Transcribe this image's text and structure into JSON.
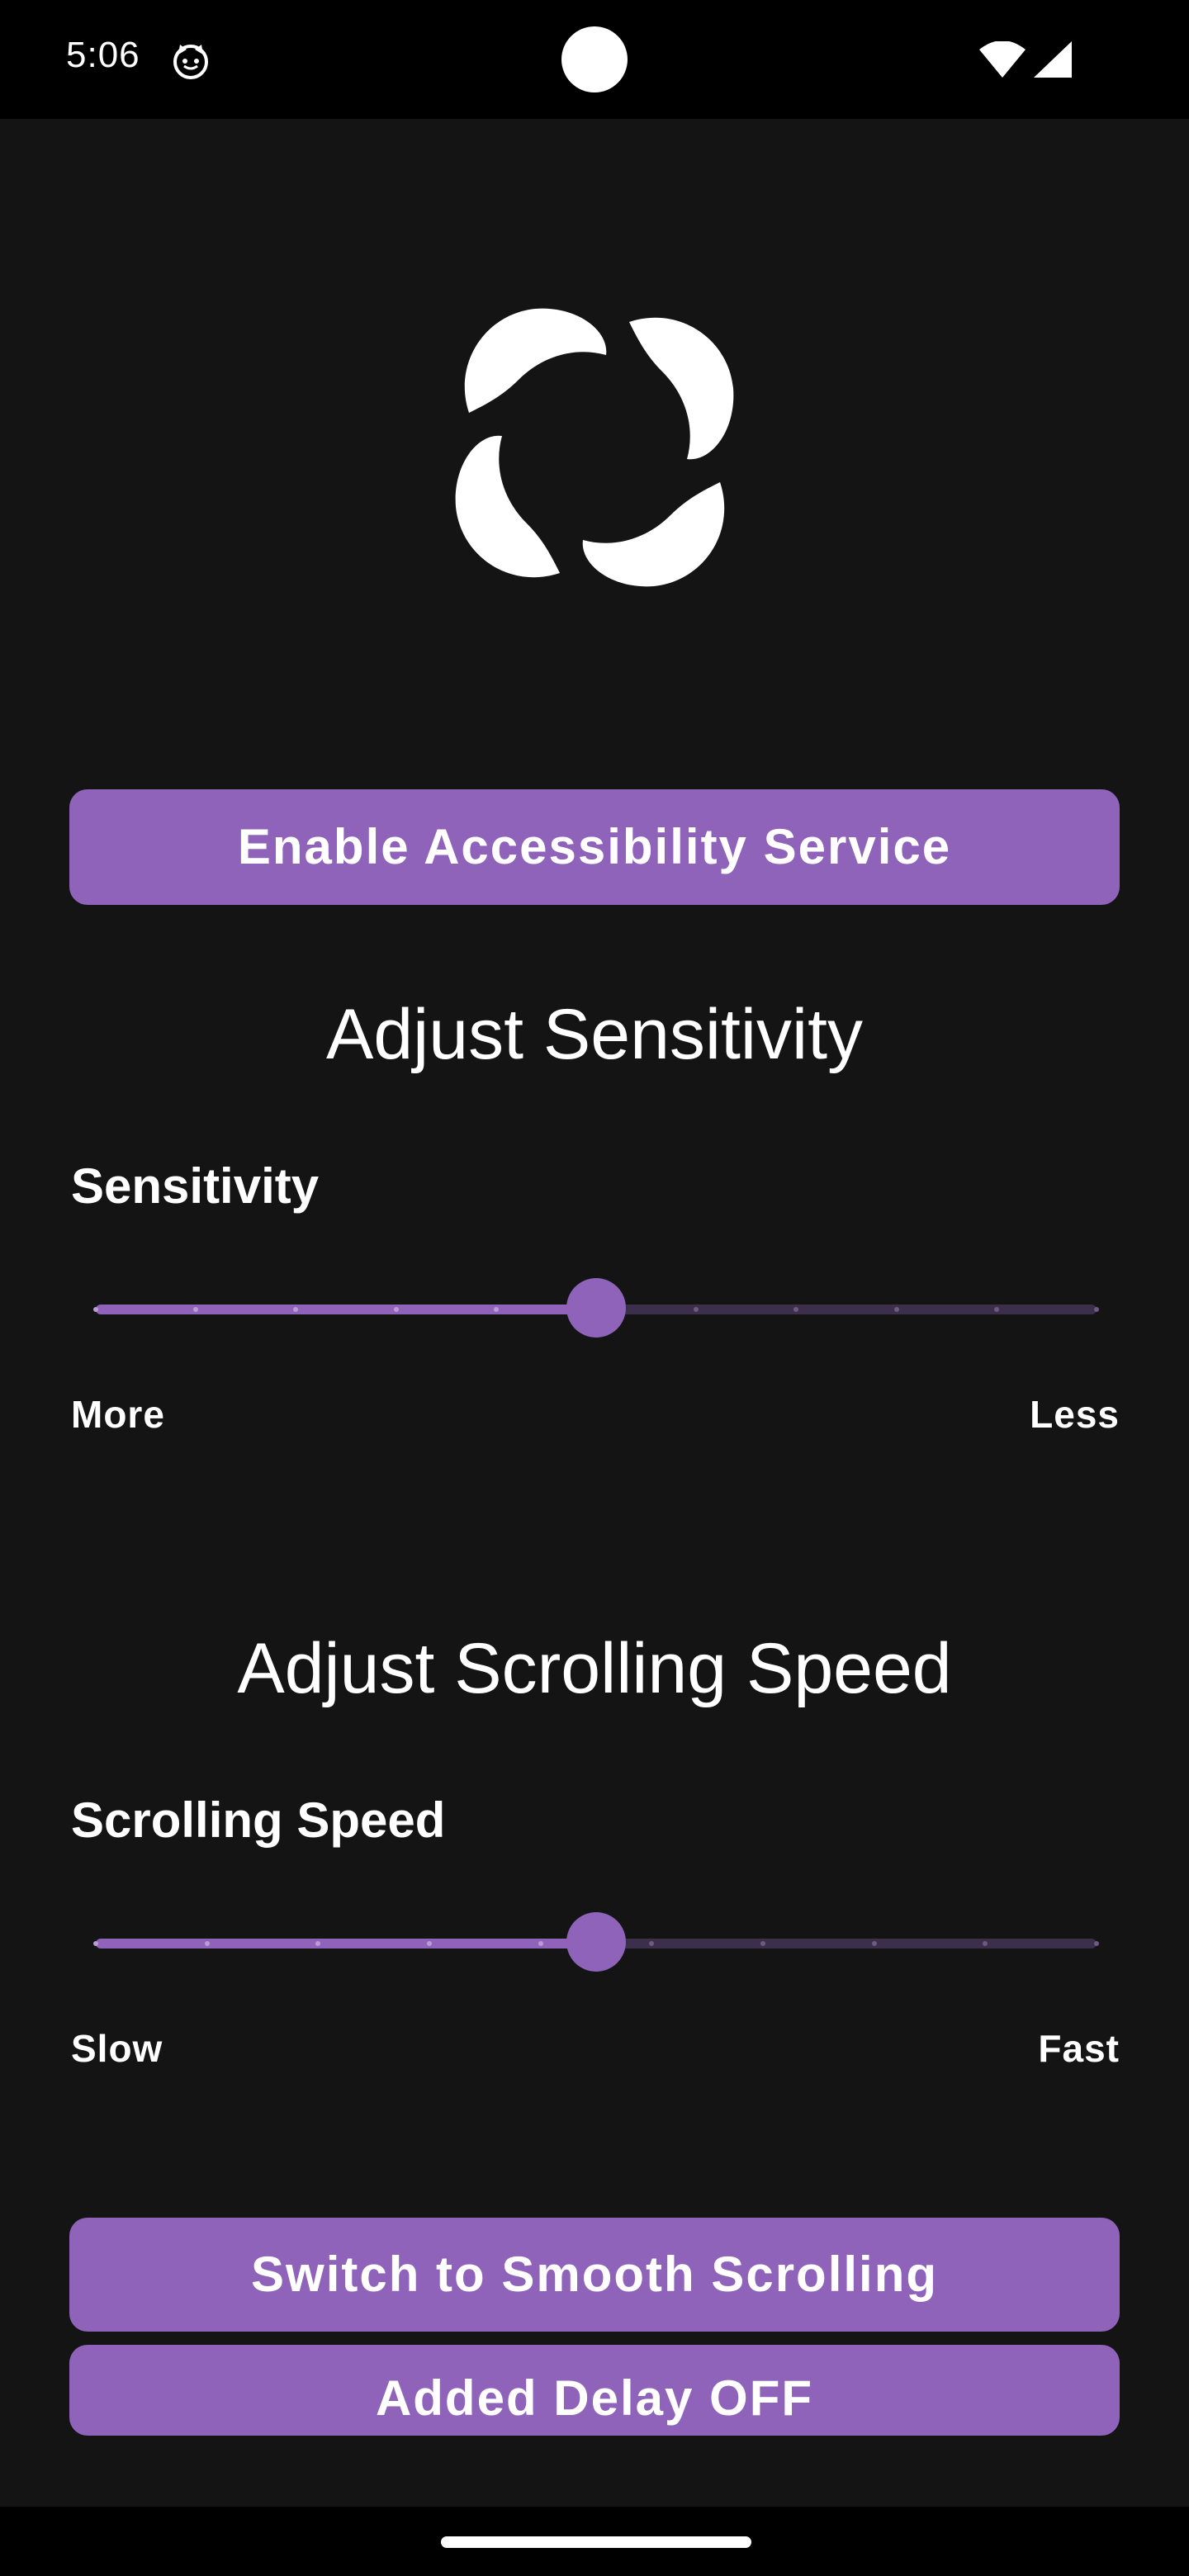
{
  "status_bar": {
    "time": "5:06",
    "icons": [
      "cat-icon",
      "wifi-icon",
      "signal-icon"
    ]
  },
  "logo": {
    "icon": "pinwheel-logo-icon"
  },
  "enable_button": {
    "label": "Enable Accessibility Service"
  },
  "sensitivity": {
    "section_title": "Adjust Sensitivity",
    "slider_label": "Sensitivity",
    "min_label": "More",
    "max_label": "Less",
    "steps": 10,
    "value_fraction": 0.5
  },
  "scrolling_speed": {
    "section_title": "Adjust Scrolling Speed",
    "slider_label": "Scrolling Speed",
    "min_label": "Slow",
    "max_label": "Fast",
    "steps": 9,
    "value_fraction": 0.5
  },
  "smooth_button": {
    "label": "Switch to Smooth Scrolling"
  },
  "delay_button": {
    "label": "Added Delay OFF"
  },
  "colors": {
    "accent": "#8e63b9",
    "background": "#141414",
    "track_inactive": "#3c2f4b"
  }
}
